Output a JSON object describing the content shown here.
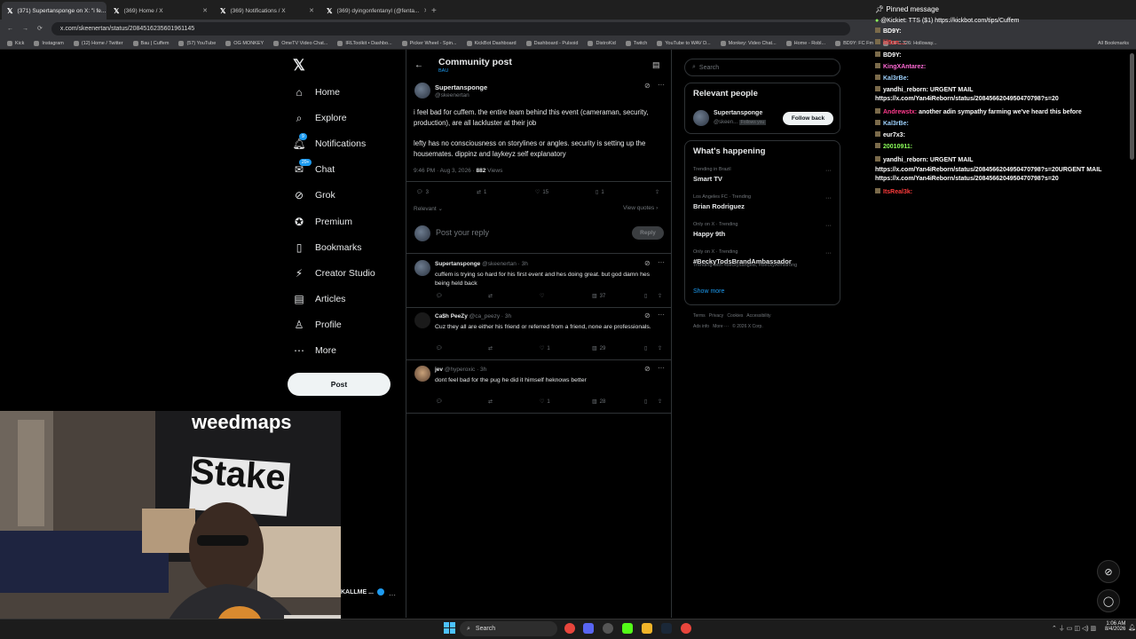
{
  "browser": {
    "tabs": [
      {
        "title": "(371) Supertansponge on X: \"i fe...",
        "active": true
      },
      {
        "title": "(369) Home / X",
        "active": false
      },
      {
        "title": "(369) Notifications / X",
        "active": false
      },
      {
        "title": "(369) dyingonfentanyl (@fenta...",
        "active": false
      }
    ],
    "url": "x.com/skeenertan/status/2084516235601961145",
    "bookmarks": [
      "Kick",
      "Instagram",
      "(12) Home / Twitter",
      "Bau | Cuffem",
      "(57) YouTube",
      "OG MONKEY",
      "OmeTV Video Chat...",
      "IRLToolkit • Dashbo...",
      "Picker Wheel - Spin...",
      "KickBot Dashboard",
      "Dashboard - Pulsoid",
      "DistroKid",
      "Twitch",
      "YouTube to WAV D...",
      "Monkey: Video Chat...",
      "Home - Robl...",
      "BD9Y: FC Fm",
      "UFC 326: Holloway..."
    ],
    "all_bookmarks": "All Bookmarks"
  },
  "nav": {
    "items": [
      {
        "label": "Home",
        "icon": "home-icon"
      },
      {
        "label": "Explore",
        "icon": "search-icon"
      },
      {
        "label": "Notifications",
        "icon": "bell-icon",
        "badge": "9"
      },
      {
        "label": "Chat",
        "icon": "chat-icon",
        "badge": "20+"
      },
      {
        "label": "Grok",
        "icon": "grok-icon"
      },
      {
        "label": "Premium",
        "icon": "premium-icon"
      },
      {
        "label": "Bookmarks",
        "icon": "bookmark-icon"
      },
      {
        "label": "Creator Studio",
        "icon": "studio-icon"
      },
      {
        "label": "Articles",
        "icon": "articles-icon"
      },
      {
        "label": "Profile",
        "icon": "person-icon"
      },
      {
        "label": "More",
        "icon": "more-icon"
      }
    ],
    "post_button": "Post",
    "account_name": "KALLME ..."
  },
  "post": {
    "header_title": "Community post",
    "community": "BAU",
    "author_name": "Supertansponge",
    "author_handle": "@skeenertan",
    "text_p1": "i feel bad for cuffem. the entire team behind this event (cameraman, security, production), are all lackluster at their job",
    "text_p2": "lefty has no consciousness on storylines or angles. security is setting up the housemates. dippinz and laykeyz self explanatory",
    "timestamp": "9:46 PM · Aug 3, 2026 ·",
    "views_count": "882",
    "views_label": "Views",
    "replies": "3",
    "reposts": "1",
    "likes": "15",
    "bookmarks": "1",
    "sort_label": "Relevant",
    "view_quotes": "View quotes",
    "reply_placeholder": "Post your reply",
    "reply_button": "Reply"
  },
  "replies": [
    {
      "name": "Supertansponge",
      "handle": "@skeenertan · 3h",
      "text": "cuffem is trying so hard for his first event and hes doing great. but god damn hes being held back",
      "likes": "",
      "views": "37"
    },
    {
      "name": "Ca$h PeeZy",
      "handle": "@ca_peezy · 3h",
      "text": "Cuz they all are either his friend or referred from a friend, none are professionals.",
      "likes": "1",
      "views": "29"
    },
    {
      "name": "jev",
      "handle": "@hyperoxic · 3h",
      "text": "dont feel bad for the pug he did it himself heknows better",
      "likes": "1",
      "views": "28"
    }
  ],
  "right": {
    "search_placeholder": "Search",
    "relevant_title": "Relevant people",
    "person_name": "Supertansponge",
    "person_handle": "@skeen...",
    "follows_you": "Follows you",
    "follow_back": "Follow back",
    "happening_title": "What's happening",
    "trends": [
      {
        "context": "Trending in Brazil",
        "name": "Smart TV",
        "extra": ""
      },
      {
        "context": "Los Angeles FC · Trending",
        "name": "Brian Rodriguez",
        "extra": ""
      },
      {
        "context": "Only on X · Trending",
        "name": "Happy 9th",
        "extra": ""
      },
      {
        "context": "Only on X · Trending",
        "name": "#BeckyTodsBrandAmbassador",
        "extra": "Trending with #beckysangels, #BeckyArmstrong"
      }
    ],
    "show_more": "Show more",
    "footer1": "Terms   Privacy   Cookies   Accessibility",
    "footer2": "Ads info   More ···   © 2026 X Corp."
  },
  "chat": {
    "pinned_label": "Pinned message",
    "pinned_text": "@Kickiet: TTS ($1) https://kickbot.com/tips/Cuffem",
    "lines": [
      {
        "user": "BD9Y:",
        "msg": "",
        "color": "#ffffff"
      },
      {
        "user": "lil5sn...:",
        "msg": "",
        "color": "#ff3b3b"
      },
      {
        "user": "BD9Y:",
        "msg": "",
        "color": "#ffffff"
      },
      {
        "user": "KingXAntarez:",
        "msg": "",
        "color": "#ff6ad5"
      },
      {
        "user": "Kal3rBe:",
        "msg": "",
        "color": "#9fd3ff"
      },
      {
        "user": "yandhi_reborn:",
        "msg": "URGENT MAIL",
        "color": "#ffffff"
      },
      {
        "user": "",
        "msg": "https://x.com/Yan4iReborn/status/2084566204950470798?s=20",
        "color": "#ffffff"
      },
      {
        "user": "Andrewstx:",
        "msg": "another adin sympathy farming we've heard this before",
        "color": "#ff3b8d"
      },
      {
        "user": "Kal3rBe:",
        "msg": "",
        "color": "#9fd3ff"
      },
      {
        "user": "eur7x3:",
        "msg": "",
        "color": "#ffffff"
      },
      {
        "user": "20010911:",
        "msg": "",
        "color": "#8cff5a"
      },
      {
        "user": "yandhi_reborn:",
        "msg": "URGENT MAIL",
        "color": "#ffffff"
      },
      {
        "user": "",
        "msg": "https://x.com/Yan4iReborn/status/2084566204950470798?s=20URGENT MAIL",
        "color": "#ffffff"
      },
      {
        "user": "",
        "msg": "https://x.com/Yan4iReborn/status/2084566204950470798?s=20",
        "color": "#ffffff"
      },
      {
        "user": "ItsReal3k:",
        "msg": "",
        "color": "#ff3b3b"
      }
    ]
  },
  "cam": {
    "banner_top": "weedmaps",
    "banner_main": "Stake"
  },
  "taskbar": {
    "search": "Search",
    "time": "1:06 AM",
    "date": "8/4/2026"
  }
}
